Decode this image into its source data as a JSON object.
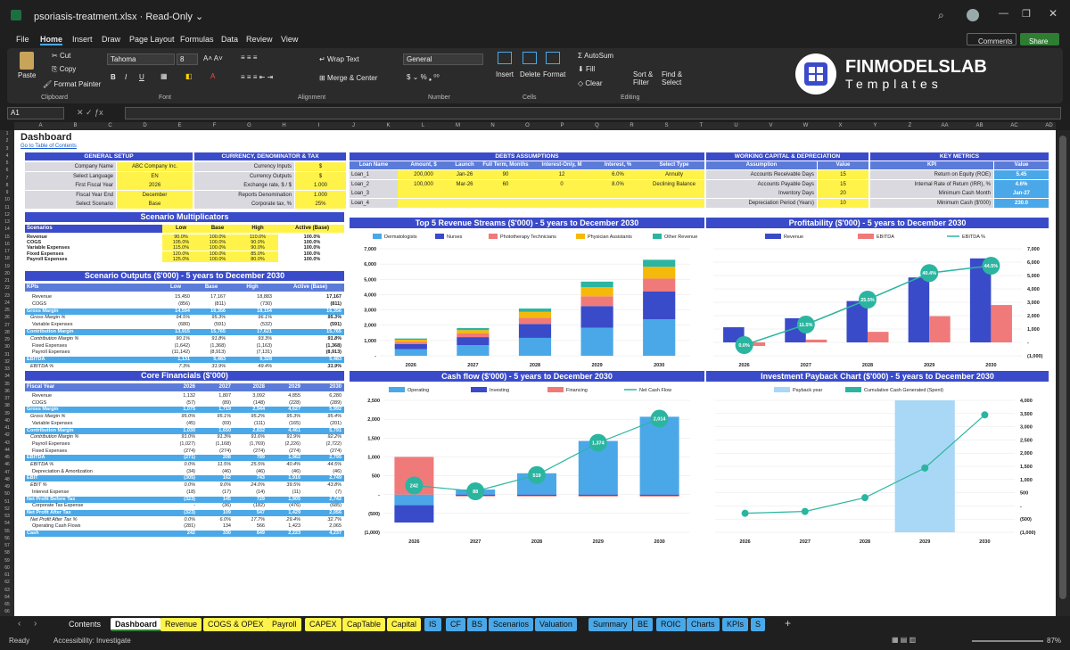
{
  "window": {
    "filename": "psoriasis-treatment.xlsx",
    "mode": "Read-Only"
  },
  "menu": [
    "File",
    "Home",
    "Insert",
    "Draw",
    "Page Layout",
    "Formulas",
    "Data",
    "Review",
    "View"
  ],
  "comments_label": "Comments",
  "share_label": "Share",
  "ribbon": {
    "paste": "Paste",
    "cut": "Cut",
    "copy": "Copy",
    "format_painter": "Format Painter",
    "clipboard": "Clipboard",
    "font_name": "Tahoma",
    "font_size": "8",
    "font": "Font",
    "wrap": "Wrap Text",
    "merge": "Merge & Center",
    "alignment": "Alignment",
    "number_format": "General",
    "number": "Number",
    "insert": "Insert",
    "delete": "Delete",
    "format": "Format",
    "cells": "Cells",
    "autosum": "AutoSum",
    "fill": "Fill",
    "clear": "Clear",
    "sort": "Sort & Filter",
    "find": "Find & Select",
    "editing": "Editing"
  },
  "brand": {
    "name": "FINMODELSLAB",
    "sub": "Templates"
  },
  "namebox": "A1",
  "columns": [
    "A",
    "B",
    "C",
    "D",
    "E",
    "F",
    "G",
    "H",
    "I",
    "J",
    "K",
    "L",
    "M",
    "N",
    "O",
    "P",
    "Q",
    "R",
    "S",
    "T",
    "U",
    "V",
    "W",
    "X",
    "Y",
    "Z",
    "AA",
    "AB",
    "AC",
    "AD"
  ],
  "dashboard": {
    "title": "Dashboard",
    "toc": "Go to Table of Contents"
  },
  "general_setup": {
    "title": "GENERAL SETUP",
    "rows": [
      [
        "Company Name",
        "ABC Company Inc."
      ],
      [
        "Select Language",
        "EN"
      ],
      [
        "First Fiscal Year",
        "2026"
      ],
      [
        "Fiscal Year End",
        "December"
      ],
      [
        "Select Scenario",
        "Base"
      ]
    ]
  },
  "currency": {
    "title": "CURRENCY, DENOMINATOR & TAX",
    "rows": [
      [
        "Currency Inputs",
        "$"
      ],
      [
        "Currency Outputs",
        "$"
      ],
      [
        "Exchange rate, $ / $",
        "1.000"
      ],
      [
        "Reports Denomination",
        "1.000"
      ],
      [
        "Corporate tax, %",
        "25%"
      ]
    ]
  },
  "debts": {
    "title": "DEBTS ASSUMPTIONS",
    "headers": [
      "Loan Name",
      "Amount, $",
      "Launch",
      "Full Term, Months",
      "Interest-Only, M",
      "Interest, %",
      "Select Type"
    ],
    "rows": [
      [
        "Loan_1",
        "200,000",
        "Jan-26",
        "90",
        "12",
        "6.0%",
        "Annuity"
      ],
      [
        "Loan_2",
        "100,000",
        "Mar-26",
        "60",
        "0",
        "8.0%",
        "Declining Balance"
      ],
      [
        "Loan_3",
        "",
        "",
        "",
        "",
        "",
        ""
      ],
      [
        "Loan_4",
        "",
        "",
        "",
        "",
        "",
        ""
      ]
    ]
  },
  "working_capital": {
    "title": "WORKING CAPITAL & DEPRECIATION",
    "headers": [
      "Assumption",
      "Value"
    ],
    "rows": [
      [
        "Accounts Receivable Days",
        "15"
      ],
      [
        "Accounts Payable Days",
        "15"
      ],
      [
        "Inventory Days",
        "20"
      ],
      [
        "Depreciation Period (Years)",
        "10"
      ]
    ]
  },
  "key_metrics": {
    "title": "KEY METRICS",
    "headers": [
      "KPI",
      "Value"
    ],
    "rows": [
      [
        "Return on Equity (ROE)",
        "5.45"
      ],
      [
        "Internal Rate of Return (IRR), %",
        "4.6%"
      ],
      [
        "Minimum Cash Month",
        "Jan-27"
      ],
      [
        "Minimum Cash ($'000)",
        "230.0"
      ]
    ]
  },
  "scenario_mult": {
    "title": "Scenario Multiplicators",
    "headers": [
      "Scenarios",
      "Low",
      "Base",
      "High",
      "Active (Base)"
    ],
    "rows": [
      [
        "Revenue",
        "90.0%",
        "100.0%",
        "110.0%",
        "100.0%"
      ],
      [
        "COGS",
        "105.0%",
        "100.0%",
        "90.0%",
        "100.0%"
      ],
      [
        "Variable Expenses",
        "115.0%",
        "100.0%",
        "90.0%",
        "100.0%"
      ],
      [
        "Fixed Expenses",
        "120.0%",
        "100.0%",
        "85.0%",
        "100.0%"
      ],
      [
        "Payroll Expenses",
        "125.0%",
        "100.0%",
        "80.0%",
        "100.0%"
      ]
    ]
  },
  "scenario_out": {
    "title": "Scenario Outputs ($'000) - 5 years to December 2030",
    "headers": [
      "KPIs",
      "Low",
      "Base",
      "High",
      "Active (Base)"
    ],
    "rows": [
      [
        "Revenue",
        "15,450",
        "17,167",
        "18,883",
        "17,167",
        0
      ],
      [
        "COGS",
        "(856)",
        "(811)",
        "(730)",
        "(811)",
        0
      ],
      [
        "Gross Margin",
        "14,594",
        "16,356",
        "18,154",
        "16,356",
        1
      ],
      [
        "Gross Margin %",
        "94.5%",
        "95.3%",
        "96.1%",
        "95.3%",
        2
      ],
      [
        "Variable Expenses",
        "(680)",
        "(591)",
        "(532)",
        "(591)",
        0
      ],
      [
        "Contribution Margin",
        "13,915",
        "15,765",
        "17,621",
        "15,765",
        1
      ],
      [
        "Contribution Margin %",
        "90.1%",
        "91.8%",
        "93.3%",
        "91.8%",
        2
      ],
      [
        "Fixed Expenses",
        "(1,642)",
        "(1,368)",
        "(1,163)",
        "(1,368)",
        0
      ],
      [
        "Payroll Expenses",
        "(11,142)",
        "(8,913)",
        "(7,131)",
        "(8,913)",
        0
      ],
      [
        "EBITDA",
        "1,131",
        "5,483",
        "9,328",
        "5,483",
        1
      ],
      [
        "EBITDA %",
        "7.3%",
        "31.9%",
        "49.4%",
        "31.9%",
        2
      ]
    ]
  },
  "core": {
    "title": "Core Financials ($'000)",
    "headers": [
      "Fiscal Year",
      "2026",
      "2027",
      "2028",
      "2029",
      "2030"
    ],
    "rows": [
      [
        "Revenue",
        "1,132",
        "1,807",
        "3,092",
        "4,855",
        "6,280",
        0
      ],
      [
        "COGS",
        "(57)",
        "(89)",
        "(148)",
        "(228)",
        "(289)",
        0
      ],
      [
        "Gross Margin",
        "1,075",
        "1,719",
        "2,944",
        "4,627",
        "5,992",
        1
      ],
      [
        "Gross Margin %",
        "95.0%",
        "95.1%",
        "95.2%",
        "95.3%",
        "95.4%",
        2
      ],
      [
        "Variable Expenses",
        "(45)",
        "(69)",
        "(111)",
        "(165)",
        "(201)",
        0
      ],
      [
        "Contribution Margin",
        "1,030",
        "1,650",
        "2,832",
        "4,461",
        "5,791",
        1
      ],
      [
        "Contribution Margin %",
        "91.0%",
        "91.3%",
        "91.6%",
        "91.9%",
        "92.2%",
        2
      ],
      [
        "Payroll Expenses",
        "(1,027)",
        "(1,168)",
        "(1,769)",
        "(2,226)",
        "(2,722)",
        0
      ],
      [
        "Fixed Expenses",
        "(274)",
        "(274)",
        "(274)",
        "(274)",
        "(274)",
        0
      ],
      [
        "EBITDA",
        "(271)",
        "208",
        "789",
        "1,962",
        "2,795",
        1
      ],
      [
        "EBITDA %",
        "0.0%",
        "11.5%",
        "25.5%",
        "40.4%",
        "44.5%",
        2
      ],
      [
        "Depreciation & Amortization",
        "(34)",
        "(46)",
        "(46)",
        "(46)",
        "(46)",
        0
      ],
      [
        "EBIT",
        "(305)",
        "162",
        "743",
        "1,916",
        "2,749",
        1
      ],
      [
        "EBIT %",
        "0.0%",
        "9.0%",
        "24.0%",
        "39.5%",
        "43.8%",
        2
      ],
      [
        "Interest Expense",
        "(18)",
        "(17)",
        "(14)",
        "(11)",
        "(7)",
        0
      ],
      [
        "Net Profit Before Tax",
        "(323)",
        "145",
        "729",
        "1,905",
        "2,742",
        1
      ],
      [
        "Corporate Tax Expense",
        "-",
        "(36)",
        "(182)",
        "(476)",
        "(685)",
        0
      ],
      [
        "Net Profit After Tax",
        "(323)",
        "109",
        "547",
        "1,429",
        "2,056",
        1
      ],
      [
        "Net Profit After Tax %",
        "0.0%",
        "6.0%",
        "17.7%",
        "29.4%",
        "32.7%",
        2
      ],
      [
        "Operating Cash Flows",
        "(281)",
        "134",
        "566",
        "1,423",
        "2,065",
        0
      ],
      [
        "Cash",
        "242",
        "330",
        "849",
        "2,223",
        "4,237",
        1
      ]
    ]
  },
  "chart_data": [
    {
      "type": "bar",
      "title": "Top 5 Revenue Streams ($'000) - 5 years to December 2030",
      "categories": [
        "2026",
        "2027",
        "2028",
        "2029",
        "2030"
      ],
      "ylim": [
        0,
        7000
      ],
      "yticks": [
        "-",
        "1,000",
        "2,000",
        "3,000",
        "4,000",
        "5,000",
        "6,000",
        "7,000"
      ],
      "series": [
        {
          "name": "Dermatologists",
          "color": "#4aa8e8",
          "values": [
            430,
            690,
            1170,
            1830,
            2380
          ]
        },
        {
          "name": "Nurses",
          "color": "#3a4bc9",
          "values": [
            330,
            530,
            910,
            1420,
            1820
          ]
        },
        {
          "name": "Phototherapy Technicians",
          "color": "#f07a7a",
          "values": [
            150,
            240,
            410,
            640,
            850
          ]
        },
        {
          "name": "Physician Assistants",
          "color": "#f5b90a",
          "values": [
            140,
            220,
            380,
            600,
            770
          ]
        },
        {
          "name": "Other Revenue",
          "color": "#2bb5a0",
          "values": [
            80,
            130,
            220,
            360,
            460
          ]
        }
      ]
    },
    {
      "type": "bar",
      "title": "Profitability ($'000) - 5 years to December 2030",
      "categories": [
        "2026",
        "2027",
        "2028",
        "2029",
        "2030"
      ],
      "ylim": [
        -1000,
        7000
      ],
      "yticks": [
        "(1,000)",
        "-",
        "1,000",
        "2,000",
        "3,000",
        "4,000",
        "5,000",
        "6,000",
        "7,000"
      ],
      "series": [
        {
          "name": "Revenue",
          "color": "#3a4bc9",
          "values": [
            1132,
            1807,
            3092,
            4855,
            6280
          ]
        },
        {
          "name": "EBITDA",
          "color": "#f07a7a",
          "values": [
            -271,
            208,
            789,
            1962,
            2795
          ]
        },
        {
          "name": "EBITDA %",
          "color": "#2bb5a0",
          "type": "line",
          "values": [
            0.0,
            11.5,
            25.5,
            40.4,
            44.5
          ],
          "labels": [
            "0.0%",
            "11.5%",
            "25.5%",
            "40.4%",
            "44.5%"
          ]
        }
      ]
    },
    {
      "type": "bar",
      "title": "Cash flow ($'000) - 5 years to December 2030",
      "categories": [
        "2026",
        "2027",
        "2028",
        "2029",
        "2030"
      ],
      "ylim": [
        -1000,
        2500
      ],
      "yticks": [
        "(1,000)",
        "(500)",
        "-",
        "500",
        "1,000",
        "1,500",
        "2,000",
        "2,500"
      ],
      "series": [
        {
          "name": "Operating",
          "color": "#4aa8e8",
          "values": [
            -281,
            134,
            566,
            1423,
            2065
          ]
        },
        {
          "name": "Investing",
          "color": "#3a4bc9",
          "values": [
            -460,
            -30,
            -30,
            -30,
            -30
          ]
        },
        {
          "name": "Financing",
          "color": "#f07a7a",
          "values": [
            1000,
            -17,
            -17,
            -19,
            -21
          ]
        },
        {
          "name": "Net Cash Flow",
          "color": "#2bb5a0",
          "type": "line",
          "values": [
            242,
            88,
            519,
            1374,
            2014
          ],
          "labels": [
            "242",
            "88",
            "519",
            "1,374",
            "2,014"
          ]
        }
      ]
    },
    {
      "type": "line",
      "title": "Investment Payback Chart ($'000) - 5 years to December 2030",
      "categories": [
        "2026",
        "2027",
        "2028",
        "2029",
        "2030"
      ],
      "ylim": [
        -1000,
        4000
      ],
      "yticks": [
        "(1,000)",
        "(500)",
        "-",
        "500",
        "1,000",
        "1,500",
        "2,000",
        "2,500",
        "3,000",
        "3,500",
        "4,000"
      ],
      "series": [
        {
          "name": "Payback year",
          "color": "#a8d8f5"
        },
        {
          "name": "Cumulative Cash Generated (Spent)",
          "color": "#2bb5a0",
          "values": [
            -279,
            -210,
            312,
            1437,
            3449
          ]
        }
      ]
    }
  ],
  "sheet_tabs": [
    "Contents",
    "Dashboard",
    "Revenue",
    "COGS & OPEX",
    "Payroll",
    "CAPEX",
    "CapTable",
    "Capital",
    "IS",
    "CF",
    "BS",
    "Scenarios",
    "Valuation",
    "Summary",
    "BE",
    "ROIC",
    "Charts",
    "KPIs",
    "S"
  ],
  "status": {
    "ready": "Ready",
    "accessibility": "Accessibility: Investigate",
    "zoom": "87%"
  }
}
